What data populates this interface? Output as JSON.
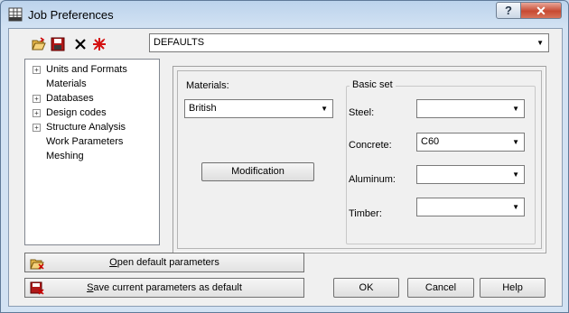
{
  "window": {
    "title": "Job Preferences",
    "help_label": "?",
    "close_label": "✕"
  },
  "toolbar": {
    "icons": [
      "open-folder-icon",
      "save-disk-icon",
      "delete-x-icon",
      "reset-star-icon"
    ],
    "preset_combo": {
      "value": "DEFAULTS"
    }
  },
  "tree": {
    "items": [
      {
        "label": "Units and Formats",
        "expandable": true
      },
      {
        "label": "Materials",
        "expandable": false
      },
      {
        "label": "Databases",
        "expandable": true
      },
      {
        "label": "Design codes",
        "expandable": true
      },
      {
        "label": "Structure Analysis",
        "expandable": true
      },
      {
        "label": "Work Parameters",
        "expandable": false
      },
      {
        "label": "Meshing",
        "expandable": false
      }
    ]
  },
  "materials": {
    "label": "Materials:",
    "value": "British",
    "modification_label": "Modification"
  },
  "basic_set": {
    "title": "Basic set",
    "steel": {
      "label": "Steel:",
      "value": ""
    },
    "concrete": {
      "label": "Concrete:",
      "value": "C60"
    },
    "aluminum": {
      "label": "Aluminum:",
      "value": ""
    },
    "timber": {
      "label": "Timber:",
      "value": ""
    }
  },
  "actions": {
    "open_default": {
      "first": "O",
      "rest": "pen default parameters"
    },
    "save_default": {
      "first": "S",
      "rest": "ave current parameters as default"
    },
    "ok_label": "OK",
    "cancel_label": "Cancel",
    "help_label": "Help"
  }
}
